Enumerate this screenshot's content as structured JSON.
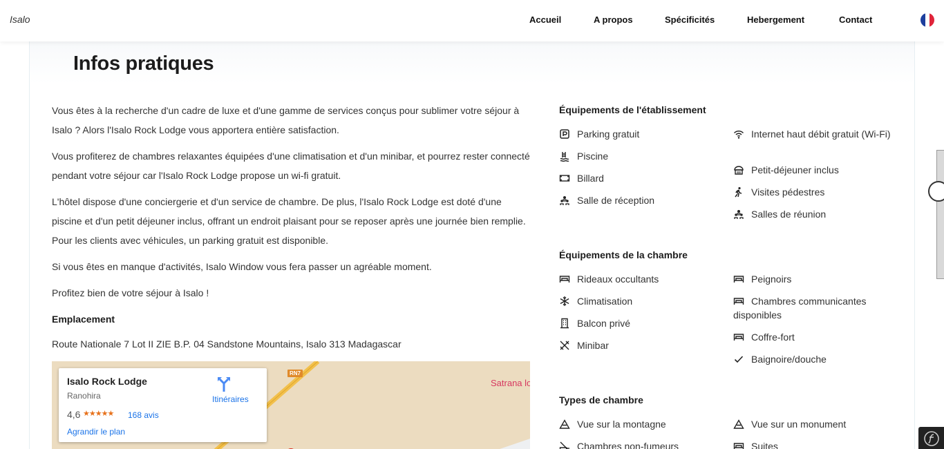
{
  "header": {
    "brand": "Isalo",
    "nav": [
      "Accueil",
      "A propos",
      "Spécificités",
      "Hebergement",
      "Contact"
    ],
    "flag_colors": [
      "#1d3f9e",
      "#ffffff",
      "#e0243a"
    ]
  },
  "main": {
    "title": "Infos pratiques",
    "paragraphs": [
      "Vous êtes à la recherche d'un cadre de luxe et d'une gamme de services conçus pour sublimer votre séjour à Isalo ? Alors l'Isalo Rock Lodge vous apportera entière satisfaction.",
      "Vous profiterez de chambres relaxantes équipées d'une climatisation et d'un minibar, et pourrez rester connecté pendant votre séjour car l'Isalo Rock Lodge propose un wi-fi gratuit.",
      "L'hôtel dispose d'une conciergerie et d'un service de chambre. De plus, l'Isalo Rock Lodge est doté d'une piscine et d'un petit déjeuner inclus, offrant un endroit plaisant pour se reposer après une journée bien remplie. Pour les clients avec véhicules, un parking gratuit est disponible.",
      "Si vous êtes en manque d'activités, Isalo Window vous fera passer un agréable moment.",
      "Profitez bien de votre séjour à Isalo !"
    ],
    "location_heading": "Emplacement",
    "address": "Route Nationale 7 Lot II ZIE B.P. 04 Sandstone Mountains, Isalo 313 Madagascar"
  },
  "map": {
    "place_name": "Isalo Rock Lodge",
    "place_area": "Ranohira",
    "rating": "4,6",
    "stars": "★★★★★",
    "reviews": "168 avis",
    "enlarge": "Agrandir le plan",
    "directions": "Itinéraires",
    "road_label": "RN7",
    "town_label": "Satrana lo"
  },
  "amenities": {
    "property_heading": "Équipements de l'établissement",
    "property_col1": [
      {
        "label": "Parking gratuit",
        "icon": "parking-icon"
      },
      {
        "label": "Piscine",
        "icon": "swimming-icon"
      },
      {
        "label": "Billard",
        "icon": "billiards-icon"
      },
      {
        "label": "Salle de réception",
        "icon": "people-icon"
      }
    ],
    "property_col2": [
      {
        "label": "Internet haut débit gratuit (Wi-Fi)",
        "icon": "wifi-icon"
      },
      {
        "label": "Petit-déjeuner inclus",
        "icon": "breakfast-icon"
      },
      {
        "label": "Visites pédestres",
        "icon": "walking-icon"
      },
      {
        "label": "Salles de réunion",
        "icon": "people-icon"
      }
    ],
    "room_heading": "Équipements de la chambre",
    "room_col1": [
      {
        "label": "Rideaux occultants",
        "icon": "bed-icon"
      },
      {
        "label": "Climatisation",
        "icon": "snowflake-icon"
      },
      {
        "label": "Balcon privé",
        "icon": "building-icon"
      },
      {
        "label": "Minibar",
        "icon": "utensils-icon"
      }
    ],
    "room_col2": [
      {
        "label": "Peignoirs",
        "icon": "bed-icon"
      },
      {
        "label": "Chambres communicantes disponibles",
        "icon": "bed-icon"
      },
      {
        "label": "Coffre-fort",
        "icon": "bed-icon"
      },
      {
        "label": "Baignoire/douche",
        "icon": "check-icon"
      }
    ],
    "types_heading": "Types de chambre",
    "types_col1": [
      {
        "label": "Vue sur la montagne",
        "icon": "mountain-icon"
      },
      {
        "label": "Chambres non-fumeurs",
        "icon": "no-smoking-icon"
      }
    ],
    "types_col2": [
      {
        "label": "Vue sur un monument",
        "icon": "mountain-icon"
      },
      {
        "label": "Suites",
        "icon": "bed-icon"
      }
    ]
  }
}
